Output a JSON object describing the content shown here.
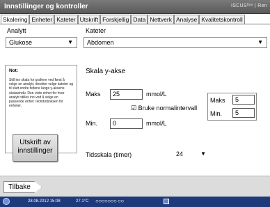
{
  "window": {
    "title": "Innstillinger og kontroller",
    "brand": "ISCUSᶠˡᵉˣ | Ren"
  },
  "tabs": [
    "Skalering",
    "Enheter",
    "Kateter",
    "Utskrift",
    "Forskjellig",
    "Data",
    "Nettverk",
    "Analyse",
    "Kvalitetskontroll"
  ],
  "analyte": {
    "label": "Analytt",
    "value": "Glukose"
  },
  "catheter": {
    "label": "Kateter",
    "value": "Abdomen"
  },
  "note": {
    "title": "Not:",
    "body": "Still inn skala for grafene ved først å velge en analytt, deretter velge kateter og til slutt endre feltene langs y-aksens skalavindu. Den viste enhet for hver analytt stilles inn ved å velge en passende enhet i komboboksen for enheter."
  },
  "print_button": "Utskrift av innstillinger",
  "yaxis": {
    "title": "Skala y-akse",
    "max_label": "Maks",
    "max_value": "25",
    "min_label": "Min.",
    "min_value": "0",
    "unit": "mmol/L",
    "normal_checkbox": "Bruke normalintervall"
  },
  "normal_interval": {
    "max_label": "Maks",
    "max_value": "5",
    "min_label": "Min.",
    "min_value": "5"
  },
  "timescale": {
    "label": "Tidsskala (timer)",
    "value": "24"
  },
  "back_button": "Tilbake",
  "statusbar": {
    "datetime": "28.08.2012 15:08",
    "temperature": "27.1°C",
    "dots": "○○○○○○○ ○○"
  },
  "colors": {
    "titlebar": "#666666",
    "statusbar": "#1f3a7a"
  }
}
